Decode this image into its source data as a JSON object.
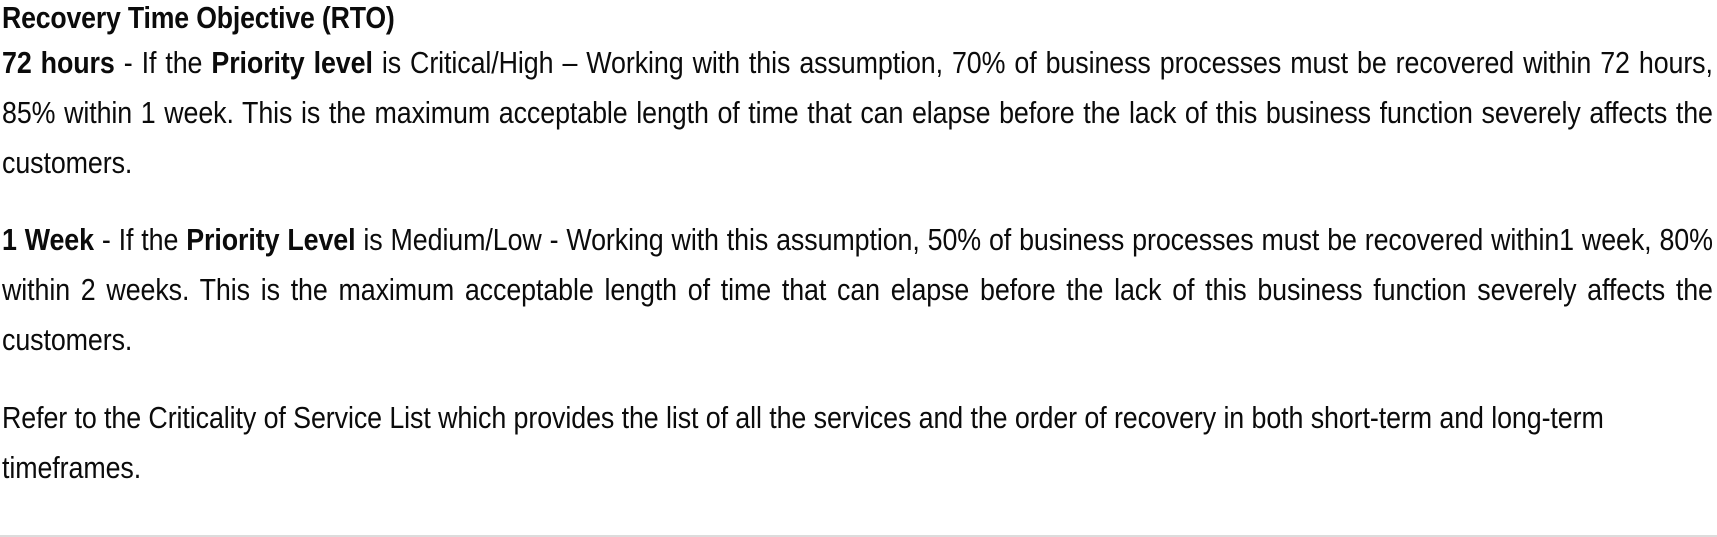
{
  "document": {
    "heading": "Recovery Time Objective (RTO)",
    "paragraphs": [
      {
        "id": "rto-72-hours",
        "lead_label": "72 hours",
        "separator": " - If the ",
        "emphasis_term": "Priority level",
        "body": " is Critical/High – Working with this assumption, 70% of business processes must be recovered within 72 hours, 85% within 1 week. This is the maximum acceptable length of time that can elapse before the lack of this business function severely affects the customers.",
        "priority_values": "Critical/High",
        "recovery_percentage": "70%",
        "recovery_window": "72 hours",
        "secondary_percentage": "85%",
        "secondary_window": "1 week"
      },
      {
        "id": "rto-1-week",
        "lead_label": "1 Week",
        "separator": " - If the ",
        "emphasis_term": "Priority Level",
        "body": " is Medium/Low - Working with this assumption, 50% of business processes must be recovered within1 week, 80% within 2 weeks. This is the maximum acceptable length of time that can elapse before the lack of this business function severely affects the customers.",
        "priority_values": "Medium/Low",
        "recovery_percentage": "50%",
        "recovery_window": "1 week",
        "secondary_percentage": "80%",
        "secondary_window": "2 weeks"
      }
    ],
    "closing_note": "Refer to the Criticality of Service List which provides the list of all the services and the order of recovery in both short-term and long-term timeframes."
  },
  "style": {
    "text_color": "#0b0b0b",
    "background_color": "#ffffff",
    "rule_color": "#dcdcdc"
  }
}
